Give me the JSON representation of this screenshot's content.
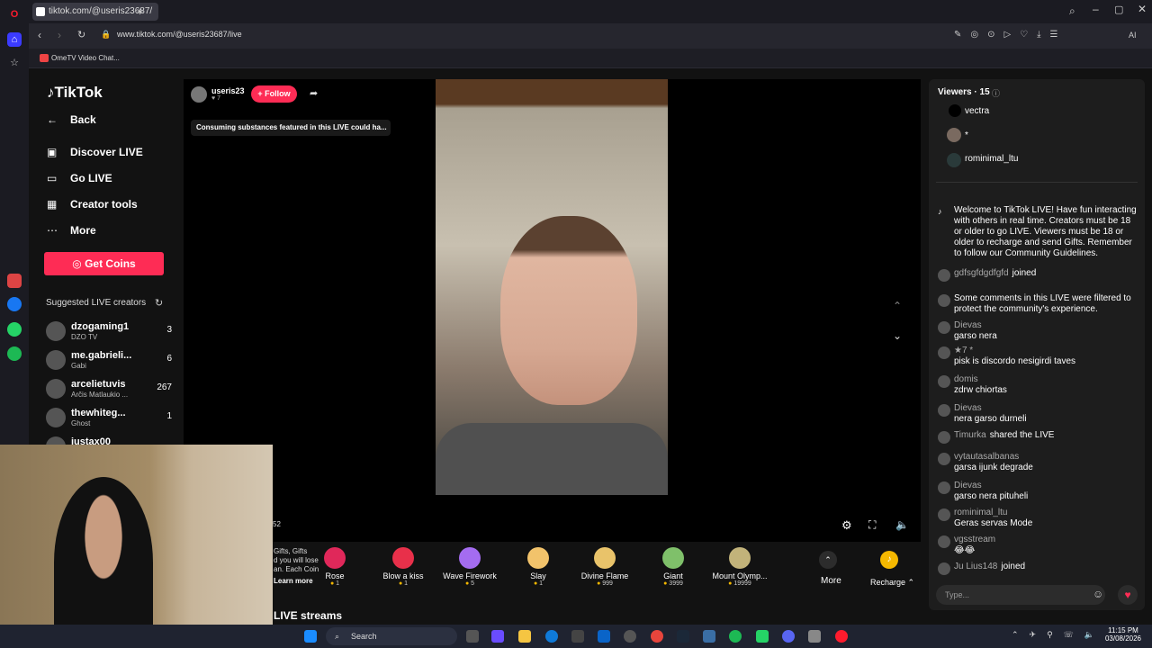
{
  "browser": {
    "tab_title": "tiktok.com/@useris23687/",
    "url": "www.tiktok.com/@useris23687/live",
    "bookmark": "OmeTV Video Chat...",
    "ai_label": "AI"
  },
  "nav": {
    "logo": "TikTok",
    "back": "Back",
    "items": [
      "Discover LIVE",
      "Go LIVE",
      "Creator tools",
      "More"
    ],
    "get_coins": "Get Coins",
    "suggested_title": "Suggested LIVE creators",
    "suggested": [
      {
        "name": "dzogaming1",
        "sub": "DZO TV",
        "count": "3"
      },
      {
        "name": "me.gabrieli...",
        "sub": "Gabi",
        "count": "6"
      },
      {
        "name": "arcelietuvis",
        "sub": "Arčis Matlaukio ...",
        "count": "267"
      },
      {
        "name": "thewhiteg...",
        "sub": "Ghost",
        "count": "1"
      },
      {
        "name": "justax00",
        "sub": "",
        "count": ""
      }
    ]
  },
  "stream": {
    "host": "useris23",
    "host_likes": "7",
    "follow": "+ Follow",
    "warning": "Consuming substances featured in this LIVE could ha...",
    "viewer_count_partial": "52",
    "gift_promo": "Gifts, Gifts\nd you will lose\nan. Each Coin",
    "learn_more": "Learn more",
    "more_streams": "LIVE streams"
  },
  "gifts": [
    {
      "name": "Rose",
      "price": "1",
      "color": "#e0285a"
    },
    {
      "name": "Blow a kiss",
      "price": "1",
      "color": "#e8304a"
    },
    {
      "name": "Wave Firework",
      "price": "5",
      "color": "#a46cf0"
    },
    {
      "name": "Slay",
      "price": "1",
      "color": "#f2c36b"
    },
    {
      "name": "Divine Flame",
      "price": "999",
      "color": "#e9c36a"
    },
    {
      "name": "Giant",
      "price": "3999",
      "color": "#7fc06a"
    },
    {
      "name": "Mount Olymp...",
      "price": "19999",
      "color": "#c2b37a"
    }
  ],
  "gift_more": "More",
  "recharge": "Recharge",
  "chat": {
    "viewers_label": "Viewers · 15",
    "viewers": [
      "vectra",
      "*",
      "rominimal_ltu"
    ],
    "welcome": "Welcome to TikTok LIVE! Have fun interacting with others in real time. Creators must be 18 or older to go LIVE. Viewers must be 18 or older to recharge and send Gifts. Remember to follow our Community Guidelines.",
    "messages": [
      {
        "user": "gdfsgfdgdfgfd",
        "text": "joined",
        "inline": true
      },
      {
        "user": "",
        "text": "Some comments in this LIVE were filtered to protect the community's experience.",
        "inline": true
      },
      {
        "user": "Dievas",
        "text": "garso nera"
      },
      {
        "user": "★7 *",
        "text": "pisk is discordo nesigirdi taves"
      },
      {
        "user": "domis",
        "text": "zdrw chiortas"
      },
      {
        "user": "Dievas",
        "text": "nera garso durneli"
      },
      {
        "user": "Timurka",
        "text": "shared the LIVE",
        "inline": true
      },
      {
        "user": "vytautasalbanas",
        "text": "garsa ijunk degrade"
      },
      {
        "user": "Dievas",
        "text": "garso nera pituheli"
      },
      {
        "user": "rominimal_ltu",
        "text": "Geras servas Mode"
      },
      {
        "user": "vgsstream",
        "text": "😂😂"
      },
      {
        "user": "Ju Lius148",
        "text": "joined",
        "inline": true
      }
    ],
    "input_placeholder": "Type..."
  },
  "taskbar": {
    "search": "Search",
    "time": "11:15 PM",
    "date": "03/08/2026"
  }
}
